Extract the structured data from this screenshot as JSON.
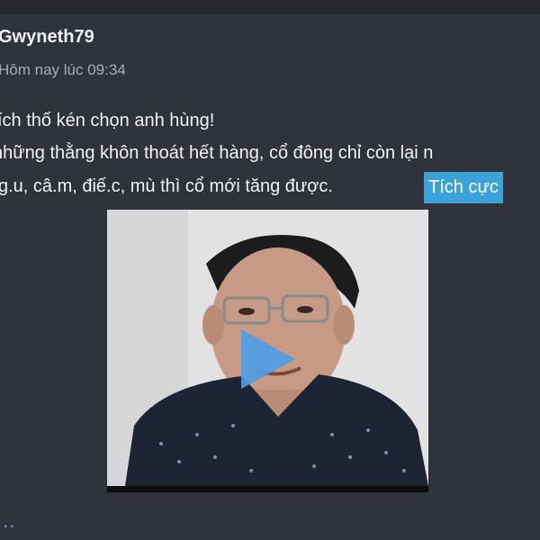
{
  "post": {
    "author": "Gwyneth79",
    "timestamp": "Hôm nay lúc 09:34",
    "body_lines": [
      "ích thố kén chọn anh hùng!",
      "những thằng khôn thoát hết hàng, cổ đông chỉ còn lại n",
      "g.u, câ.m, điế.c, mù thì cổ mới tăng được."
    ],
    "sentiment_tag": "Tích cực",
    "more_label": "..."
  },
  "video": {
    "play_icon": "play-icon"
  },
  "colors": {
    "background": "#303339",
    "tag_background": "#3ba3d9",
    "play_button": "#4f9de6",
    "link": "#6fa8e8"
  }
}
